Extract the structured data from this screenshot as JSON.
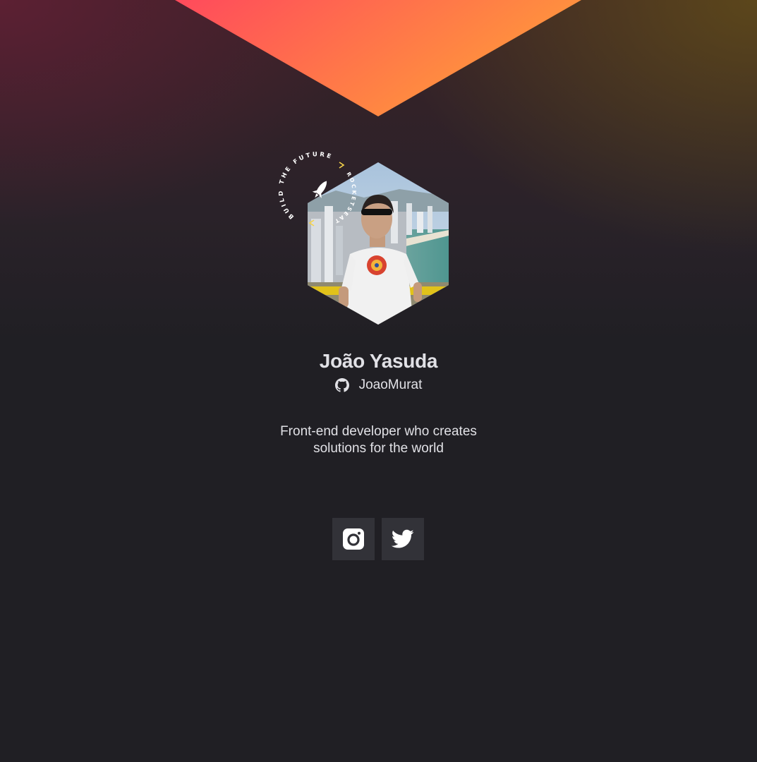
{
  "profile": {
    "name": "João Yasuda",
    "github_username": "JoaoMurat",
    "bio_line_1": "Front-end developer who creates",
    "bio_line_2": "solutions for the world"
  },
  "badge": {
    "text_top": "BUILD THE FUTURE",
    "text_side": "ROCKETSEAT"
  },
  "icons": {
    "github": "github-icon",
    "instagram": "instagram-icon",
    "twitter": "twitter-icon",
    "rocket": "rocket-icon"
  },
  "colors": {
    "background": "#201f24",
    "button": "#323238",
    "text": "#e1e1e6",
    "gradient_start": "#ff4a5c",
    "gradient_end": "#ff9a3a",
    "accent": "#f7d54a"
  }
}
